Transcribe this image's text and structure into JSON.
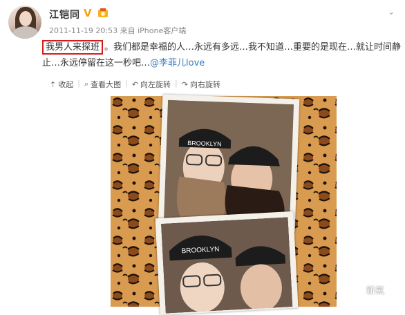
{
  "post": {
    "author": "江铠同",
    "verified": "V",
    "meta": "2011-11-19 20:53 来自 iPhone客户端",
    "highlight": "我男人来探班",
    "text": "。我们都是幸福的人…永远有多远…我不知道…重要的是现在…就让时间静止…永远停留在这一秒吧…",
    "mention": "@李菲儿love"
  },
  "toolbar": {
    "collapse": "收起",
    "view_large": "查看大图",
    "rotate_left": "向左旋转",
    "rotate_right": "向右旋转"
  },
  "photo": {
    "caption_hat1": "BROOKLYN",
    "caption_hat2": "BROOKLYN",
    "watermark": "新氧"
  },
  "icons": {
    "collapse": "arrow-up-icon",
    "view_large": "search-icon",
    "rotate": "rotate-icon",
    "dropdown": "chevron-down-icon"
  },
  "colors": {
    "highlight_border": "#d31d1d",
    "mention": "#3b7bbd",
    "vbadge": "#f7a10f"
  }
}
